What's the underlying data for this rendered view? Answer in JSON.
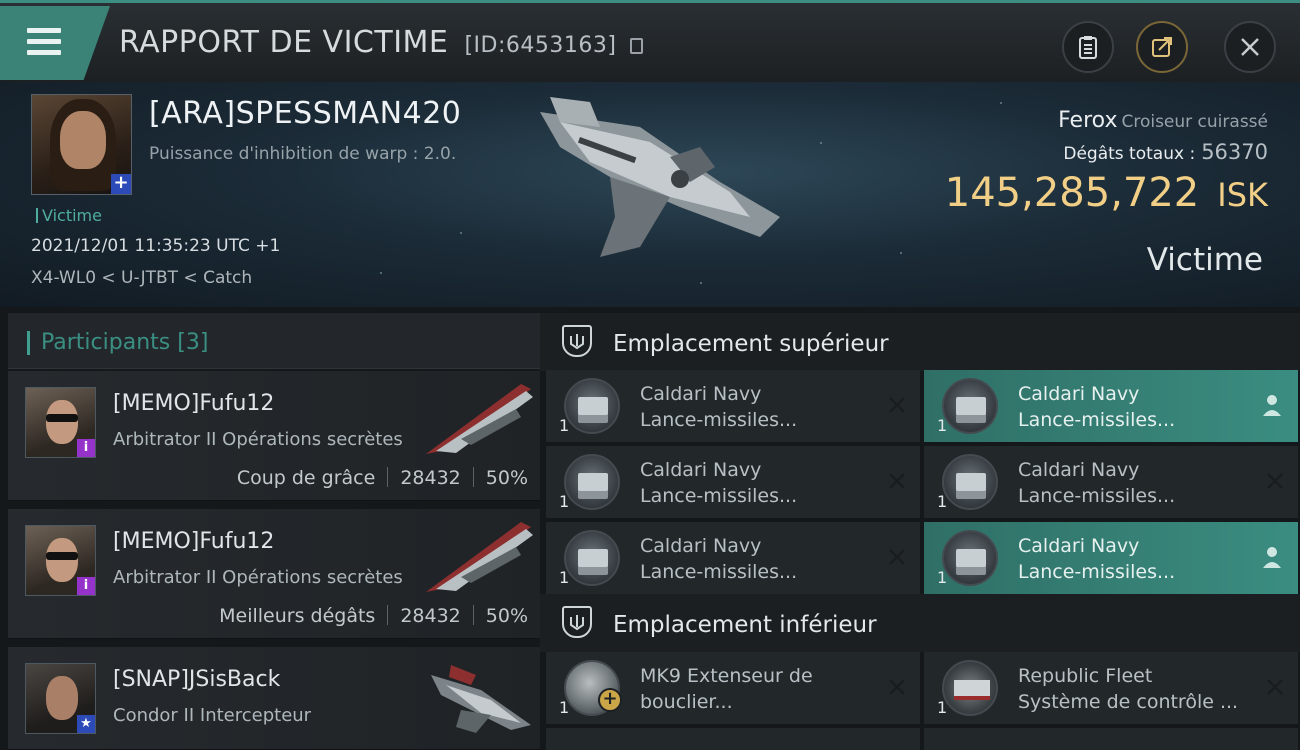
{
  "header": {
    "title": "RAPPORT DE VICTIME",
    "report_id": "[ID:6453163]"
  },
  "victim": {
    "name": "[ARA]SPESSMAN420",
    "subtitle": "Puissance d'inhibition de warp : 2.0.",
    "tag": "Victime",
    "datetime": "2021/12/01 11:35:23 UTC +1",
    "location": "X4-WL0 < U-JTBT < Catch",
    "ship_name": "Ferox",
    "ship_class": "Croiseur cuirassé",
    "damage_label": "Dégâts totaux :",
    "damage_value": "56370",
    "isk_value": "145,285,722",
    "isk_unit": "ISK",
    "role": "Victime"
  },
  "participants": {
    "title": "Participants",
    "count": "[3]",
    "items": [
      {
        "name": "[MEMO]Fufu12",
        "ship": "Arbitrator II Opérations secrètes",
        "stat_label": "Coup de grâce",
        "damage": "28432",
        "percent": "50%"
      },
      {
        "name": "[MEMO]Fufu12",
        "ship": "Arbitrator II Opérations secrètes",
        "stat_label": "Meilleurs dégâts",
        "damage": "28432",
        "percent": "50%"
      },
      {
        "name": "[SNAP]JSisBack",
        "ship": "Condor II Intercepteur"
      }
    ]
  },
  "slots": {
    "high": {
      "title": "Emplacement supérieur",
      "items": [
        {
          "qty": "1",
          "line1": "Caldari Navy",
          "line2": "Lance-missiles..."
        },
        {
          "qty": "1",
          "line1": "Caldari Navy",
          "line2": "Lance-missiles..."
        },
        {
          "qty": "1",
          "line1": "Caldari Navy",
          "line2": "Lance-missiles..."
        },
        {
          "qty": "1",
          "line1": "Caldari Navy",
          "line2": "Lance-missiles..."
        },
        {
          "qty": "1",
          "line1": "Caldari Navy",
          "line2": "Lance-missiles..."
        },
        {
          "qty": "1",
          "line1": "Caldari Navy",
          "line2": "Lance-missiles..."
        }
      ]
    },
    "low": {
      "title": "Emplacement inférieur",
      "items": [
        {
          "qty": "1",
          "line1": "MK9 Extenseur de",
          "line2": "bouclier..."
        },
        {
          "qty": "1",
          "line1": "Republic Fleet",
          "line2": "Système de contrôle ..."
        }
      ]
    }
  },
  "icons": {
    "menu": "hamburger-menu-icon",
    "copy": "copy-icon",
    "clipboard": "clipboard-icon",
    "share": "share-icon",
    "close": "close-icon"
  },
  "colors": {
    "accent": "#3b8277",
    "isk": "#f2cf86",
    "victim_tag": "#4fae9e",
    "highlight": "#3b8d81"
  }
}
